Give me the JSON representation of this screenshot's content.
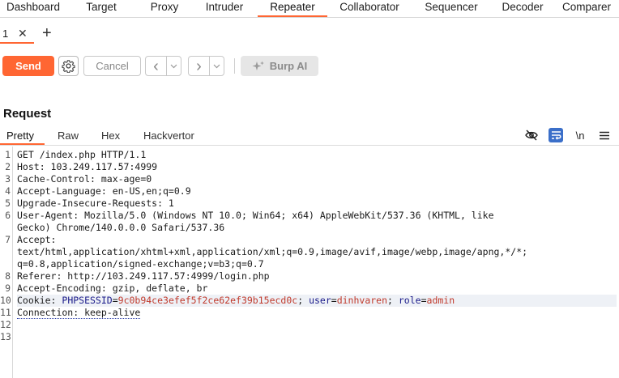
{
  "tabs": [
    {
      "label": "Dashboard",
      "active": false
    },
    {
      "label": "Target",
      "active": false
    },
    {
      "label": "Proxy",
      "active": false
    },
    {
      "label": "Intruder",
      "active": false
    },
    {
      "label": "Repeater",
      "active": true
    },
    {
      "label": "Collaborator",
      "active": false
    },
    {
      "label": "Sequencer",
      "active": false
    },
    {
      "label": "Decoder",
      "active": false
    },
    {
      "label": "Comparer",
      "active": false
    }
  ],
  "subtabs": {
    "tab_label": "1",
    "close_glyph": "✕",
    "add_glyph": "+"
  },
  "toolbar": {
    "send_label": "Send",
    "cancel_label": "Cancel",
    "back_glyph": "‹",
    "forward_glyph": "›",
    "dropdown_glyph": "⌄",
    "burp_ai_label": "Burp AI",
    "accent": "#ff6633"
  },
  "request": {
    "title": "Request",
    "view_tabs": [
      "Pretty",
      "Raw",
      "Hex",
      "Hackvertor"
    ],
    "active_view": "Pretty",
    "newline_toggle_label": "\\n",
    "line_numbers": [
      "1",
      "2",
      "3",
      "4",
      "5",
      "6",
      "",
      "7",
      "",
      "",
      "8",
      "9",
      "10",
      "11",
      "12",
      "13"
    ],
    "lines": [
      "GET /index.php HTTP/1.1",
      "Host: 103.249.117.57:4999",
      "Cache-Control: max-age=0",
      "Accept-Language: en-US,en;q=0.9",
      "Upgrade-Insecure-Requests: 1",
      "User-Agent: Mozilla/5.0 (Windows NT 10.0; Win64; x64) AppleWebKit/537.36 (KHTML, like",
      "Gecko) Chrome/140.0.0.0 Safari/537.36",
      "Accept:",
      "text/html,application/xhtml+xml,application/xml;q=0.9,image/avif,image/webp,image/apng,*/*;",
      "q=0.8,application/signed-exchange;v=b3;q=0.7",
      "Referer: http://103.249.117.57:4999/login.php",
      "Accept-Encoding: gzip, deflate, br"
    ],
    "cookie": {
      "prefix": "Cookie: ",
      "name1": "PHPSESSID",
      "val1": "9c0b94ce3efef5f2ce62ef39b15ecd0c",
      "name2": "user",
      "val2": "dinhvaren",
      "name3": "role",
      "val3": "admin"
    },
    "connection_line": "Connection: keep-alive"
  }
}
